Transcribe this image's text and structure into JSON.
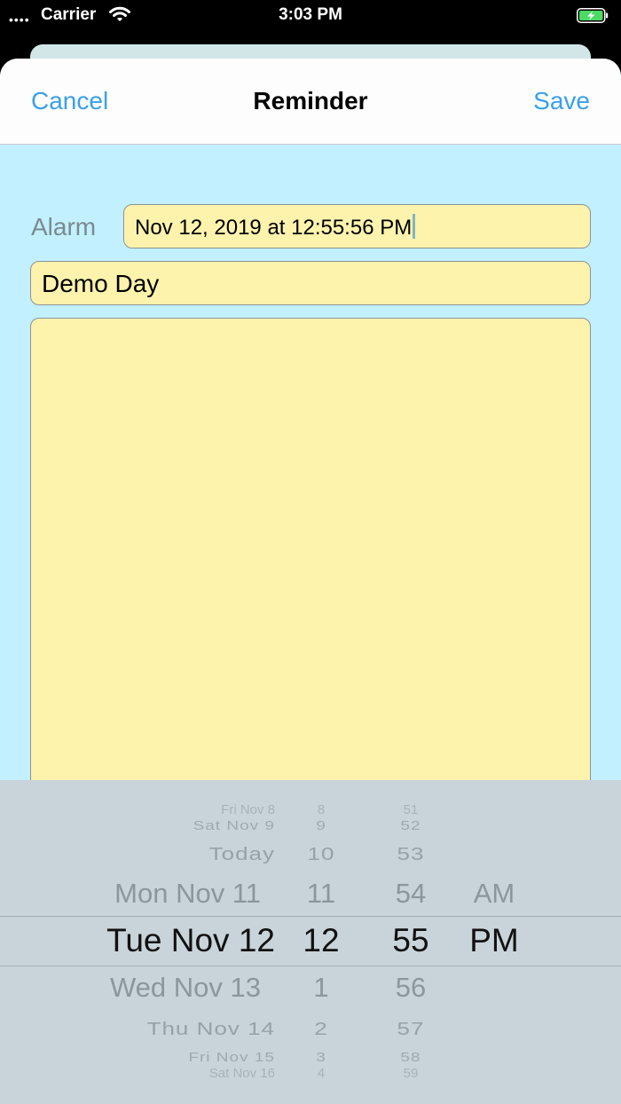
{
  "status_bar": {
    "signal": "••••",
    "carrier": "Carrier",
    "time": "3:03 PM"
  },
  "nav": {
    "cancel_label": "Cancel",
    "title": "Reminder",
    "save_label": "Save"
  },
  "form": {
    "alarm_label": "Alarm",
    "alarm_value": "Nov 12, 2019 at 12:55:56 PM",
    "title_value": "Demo Day",
    "notes_value": ""
  },
  "picker": {
    "dates": [
      "Fri Nov 8",
      "Sat Nov 9",
      "Today",
      "Mon Nov 11",
      "Tue Nov 12",
      "Wed Nov 13",
      "Thu Nov 14",
      "Fri Nov 15",
      "Sat Nov 16"
    ],
    "hours": [
      "8",
      "9",
      "10",
      "11",
      "12",
      "1",
      "2",
      "3",
      "4"
    ],
    "minutes": [
      "51",
      "52",
      "53",
      "54",
      "55",
      "56",
      "57",
      "58",
      "59"
    ],
    "ampm": [
      "",
      "",
      "",
      "AM",
      "PM",
      "",
      "",
      "",
      ""
    ],
    "selected": {
      "date": "Tue Nov 12",
      "hour": "12",
      "minute": "55",
      "ampm": "PM"
    }
  },
  "colors": {
    "accent": "#3aa0e8",
    "background": "#c2f0ff",
    "field": "#fdf3ad",
    "picker": "#c9d3da",
    "battery": "#4cd964"
  },
  "icons": {
    "wifi": "wifi-icon",
    "battery": "battery-charging-icon"
  }
}
